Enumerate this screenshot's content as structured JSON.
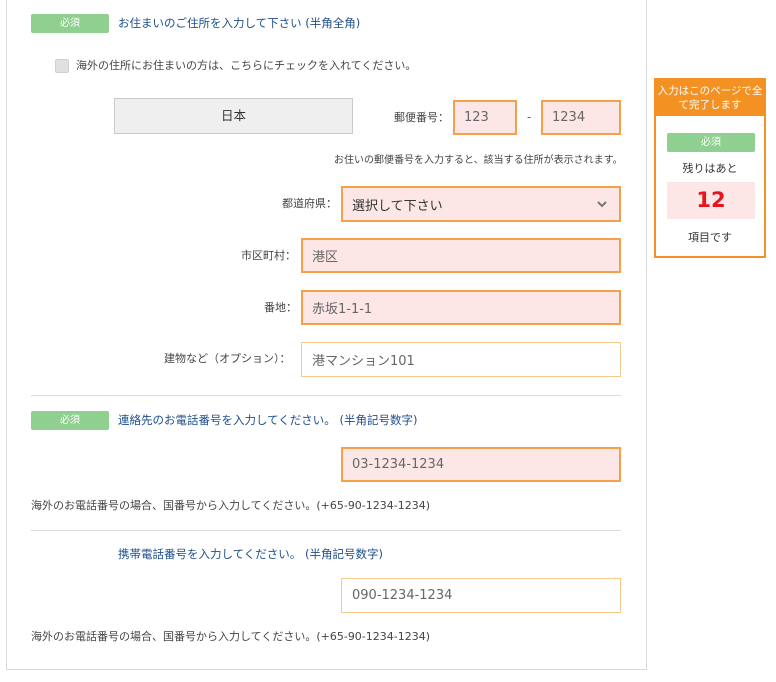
{
  "address": {
    "badge": "必須",
    "title": "お住まいのご住所を入力して下さい (半角全角)",
    "overseas_checkbox_label": "海外の住所にお住まいの方は、こちらにチェックを入れてください。",
    "country": "日本",
    "postal_label": "郵便番号：",
    "postal_first": "123",
    "postal_separator": "-",
    "postal_second": "1234",
    "postal_hint": "お住いの郵便番号を入力すると、該当する住所が表示されます。",
    "prefecture_label": "都道府県：",
    "prefecture_selected": "選択して下さい",
    "city_label": "市区町村：",
    "city_value": "港区",
    "street_label": "番地：",
    "street_value": "赤坂1-1-1",
    "building_label": "建物など（オプション）：",
    "building_value": "港マンション101"
  },
  "phone": {
    "badge": "必須",
    "title": "連絡先のお電話番号を入力してください。 (半角記号数字)",
    "value": "03-1234-1234",
    "note": "海外のお電話番号の場合、国番号から入力してください。(+65-90-1234-1234)"
  },
  "mobile": {
    "title": "携帯電話番号を入力してください。 (半角記号数字)",
    "value": "090-1234-1234",
    "note": "海外のお電話番号の場合、国番号から入力してください。(+65-90-1234-1234)"
  },
  "sidebar": {
    "header": "入力はこのページで全て完了します",
    "badge": "必須",
    "remaining_prefix": "残りはあと",
    "remaining_count": "12",
    "remaining_suffix": "項目です"
  },
  "colors": {
    "accent_orange": "#f39122",
    "required_green": "#8fcf8f",
    "field_pink": "#fde6e6",
    "title_blue": "#1f4e8c",
    "counter_red": "#e8131d"
  }
}
